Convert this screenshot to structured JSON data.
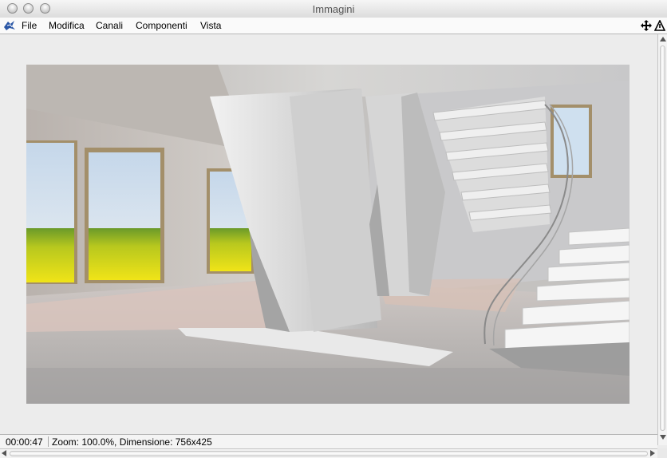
{
  "window": {
    "title": "Immagini"
  },
  "menu": {
    "items": [
      {
        "label": "File"
      },
      {
        "label": "Modifica"
      },
      {
        "label": "Canali"
      },
      {
        "label": "Componenti"
      },
      {
        "label": "Vista"
      }
    ],
    "app_icon": "cinema4d-logo-icon",
    "right_icons": [
      "move-cross-icon",
      "warning-triangle-icon"
    ]
  },
  "image": {
    "description_icon": "rendered-interior-image"
  },
  "status": {
    "time": "00:00:47",
    "info": "Zoom: 100.0%, Dimensione: 756x425"
  }
}
